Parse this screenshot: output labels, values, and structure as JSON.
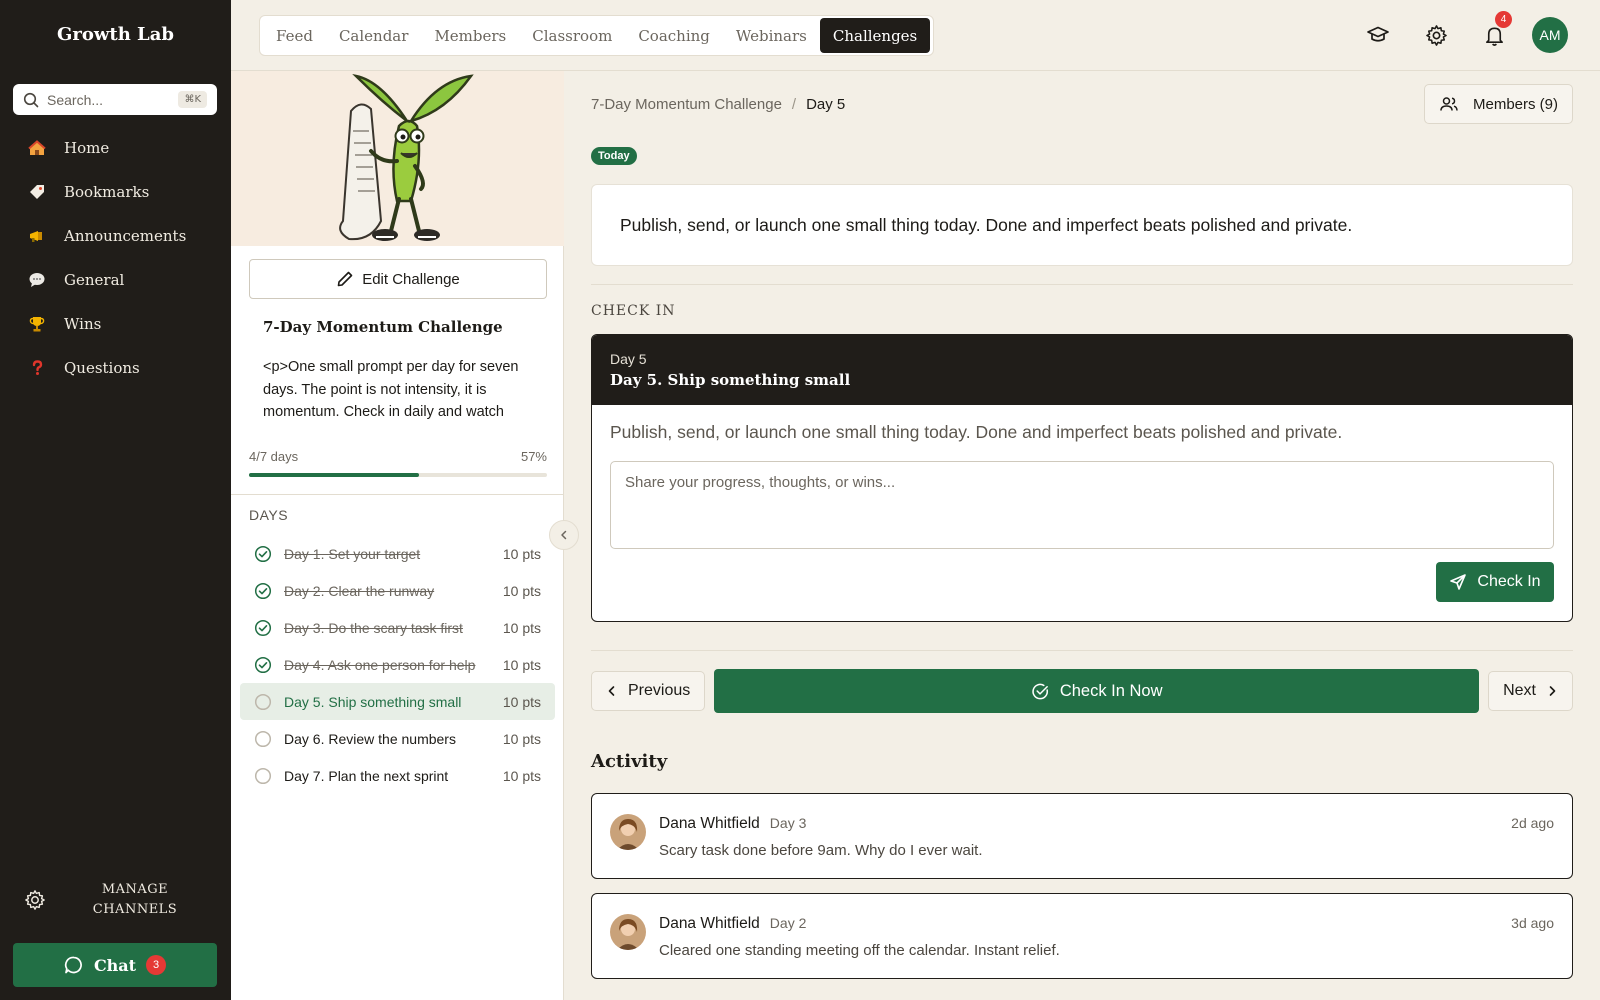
{
  "app": {
    "name": "Growth Lab"
  },
  "search": {
    "placeholder": "Search...",
    "shortcut": "⌘K"
  },
  "sidebar": {
    "items": [
      {
        "label": "Home",
        "icon": "house-icon"
      },
      {
        "label": "Bookmarks",
        "icon": "tag-icon"
      },
      {
        "label": "Announcements",
        "icon": "megaphone-icon"
      },
      {
        "label": "General",
        "icon": "speech-bubble-icon"
      },
      {
        "label": "Wins",
        "icon": "trophy-icon"
      },
      {
        "label": "Questions",
        "icon": "question-mark-icon"
      }
    ],
    "manage_line1": "MANAGE",
    "manage_line2": "CHANNELS",
    "chat_label": "Chat",
    "chat_count": "3"
  },
  "topnav": {
    "tabs": [
      "Feed",
      "Calendar",
      "Members",
      "Classroom",
      "Coaching",
      "Webinars",
      "Challenges"
    ],
    "active_tab": "Challenges",
    "notification_count": "4",
    "user_initials": "AM"
  },
  "challenge": {
    "edit_label": "Edit Challenge",
    "title": "7-Day Momentum Challenge",
    "description": "<p>One small prompt per day for seven days. The point is not intensity, it is momentum. Check in daily and watch how much moves in a week.",
    "progress_label": "4/7 days",
    "progress_percent_label": "57%",
    "progress_fraction": 0.57,
    "days_heading": "DAYS",
    "days": [
      {
        "label": "Day 1. Set your target",
        "points": "10 pts",
        "status": "done"
      },
      {
        "label": "Day 2. Clear the runway",
        "points": "10 pts",
        "status": "done"
      },
      {
        "label": "Day 3. Do the scary task first",
        "points": "10 pts",
        "status": "done"
      },
      {
        "label": "Day 4. Ask one person for help",
        "points": "10 pts",
        "status": "done"
      },
      {
        "label": "Day 5. Ship something small",
        "points": "10 pts",
        "status": "active"
      },
      {
        "label": "Day 6. Review the numbers",
        "points": "10 pts",
        "status": "todo"
      },
      {
        "label": "Day 7. Plan the next sprint",
        "points": "10 pts",
        "status": "todo"
      }
    ]
  },
  "main": {
    "breadcrumb_parent": "7-Day Momentum Challenge",
    "breadcrumb_sep": "/",
    "breadcrumb_current": "Day 5",
    "members_label": "Members (9)",
    "today_badge": "Today",
    "prompt": "Publish, send, or launch one small thing today. Done and imperfect beats polished and private.",
    "checkin_heading": "CHECK IN",
    "checkin_card": {
      "day_label": "Day 5",
      "title": "Day 5. Ship something small",
      "prompt": "Publish, send, or launch one small thing today. Done and imperfect beats polished and private.",
      "placeholder": "Share your progress, thoughts, or wins...",
      "submit_label": "Check In"
    },
    "previous_label": "Previous",
    "check_in_now_label": "Check In Now",
    "next_label": "Next",
    "activity_heading": "Activity",
    "activity": [
      {
        "author": "Dana Whitfield",
        "day": "Day 3",
        "time": "2d ago",
        "text": "Scary task done before 9am. Why do I ever wait."
      },
      {
        "author": "Dana Whitfield",
        "day": "Day 2",
        "time": "3d ago",
        "text": "Cleared one standing meeting off the calendar. Instant relief."
      }
    ]
  },
  "colors": {
    "accent": "#226f45",
    "sidebar_bg": "#201d19",
    "page_bg": "#f3efe6",
    "badge": "#e53935"
  }
}
